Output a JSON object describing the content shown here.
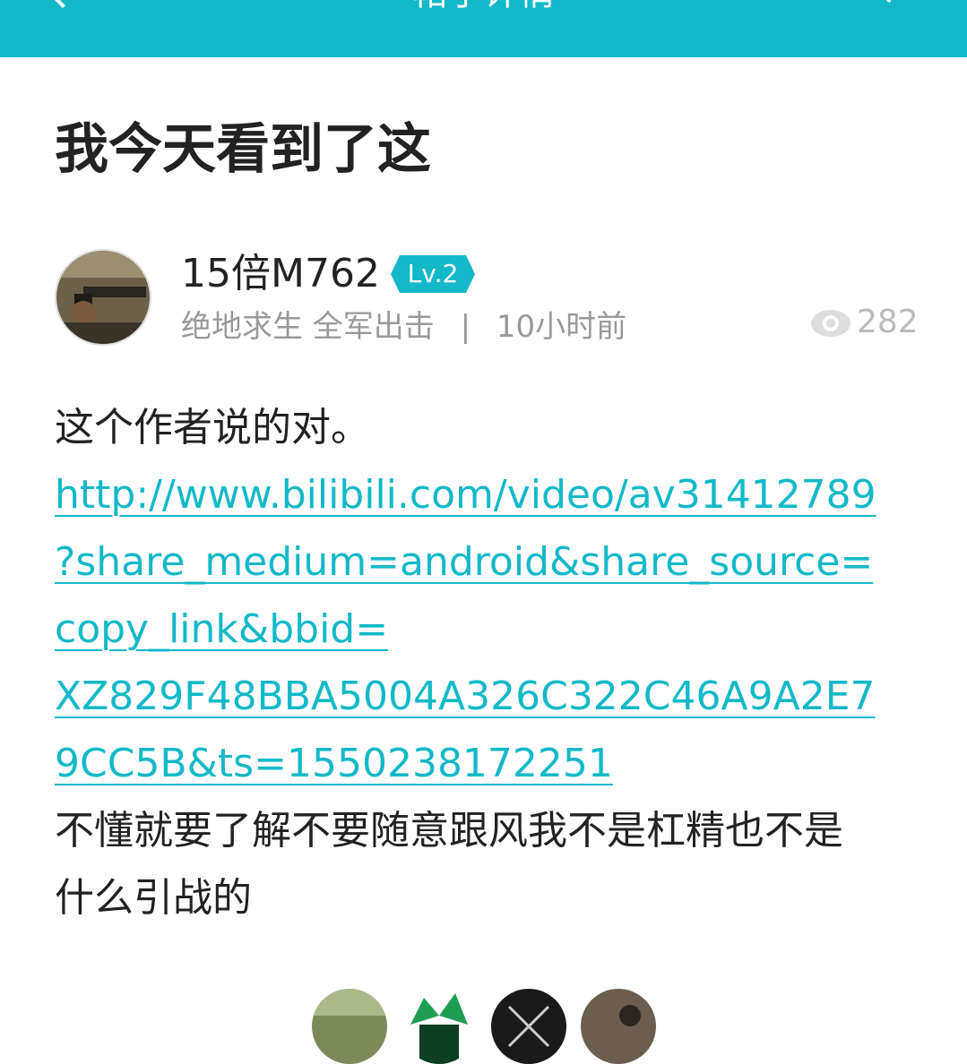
{
  "topbar": {
    "title": "帖子详情"
  },
  "post": {
    "title": "我今天看到了这",
    "author": {
      "name": "15倍M762",
      "level": "Lv.2"
    },
    "meta": {
      "section": "绝地求生 全军出击",
      "separator": "|",
      "time": "10小时前"
    },
    "views": "282",
    "content": {
      "line1": "这个作者说的对。",
      "link_lines": [
        "http://www.bilibili.com/video/av31412789",
        "?share_medium=android&share_source=",
        "copy_link&bbid=",
        "XZ829F48BBA5004A326C322C46A9A2E7",
        "9CC5B&ts=1550238172251"
      ],
      "line2": "不懂就要了解不要随意跟风我不是杠精也不是",
      "line3": "什么引战的"
    }
  },
  "colors": {
    "accent": "#13B9C8",
    "text": "#222222",
    "muted": "#999999"
  }
}
